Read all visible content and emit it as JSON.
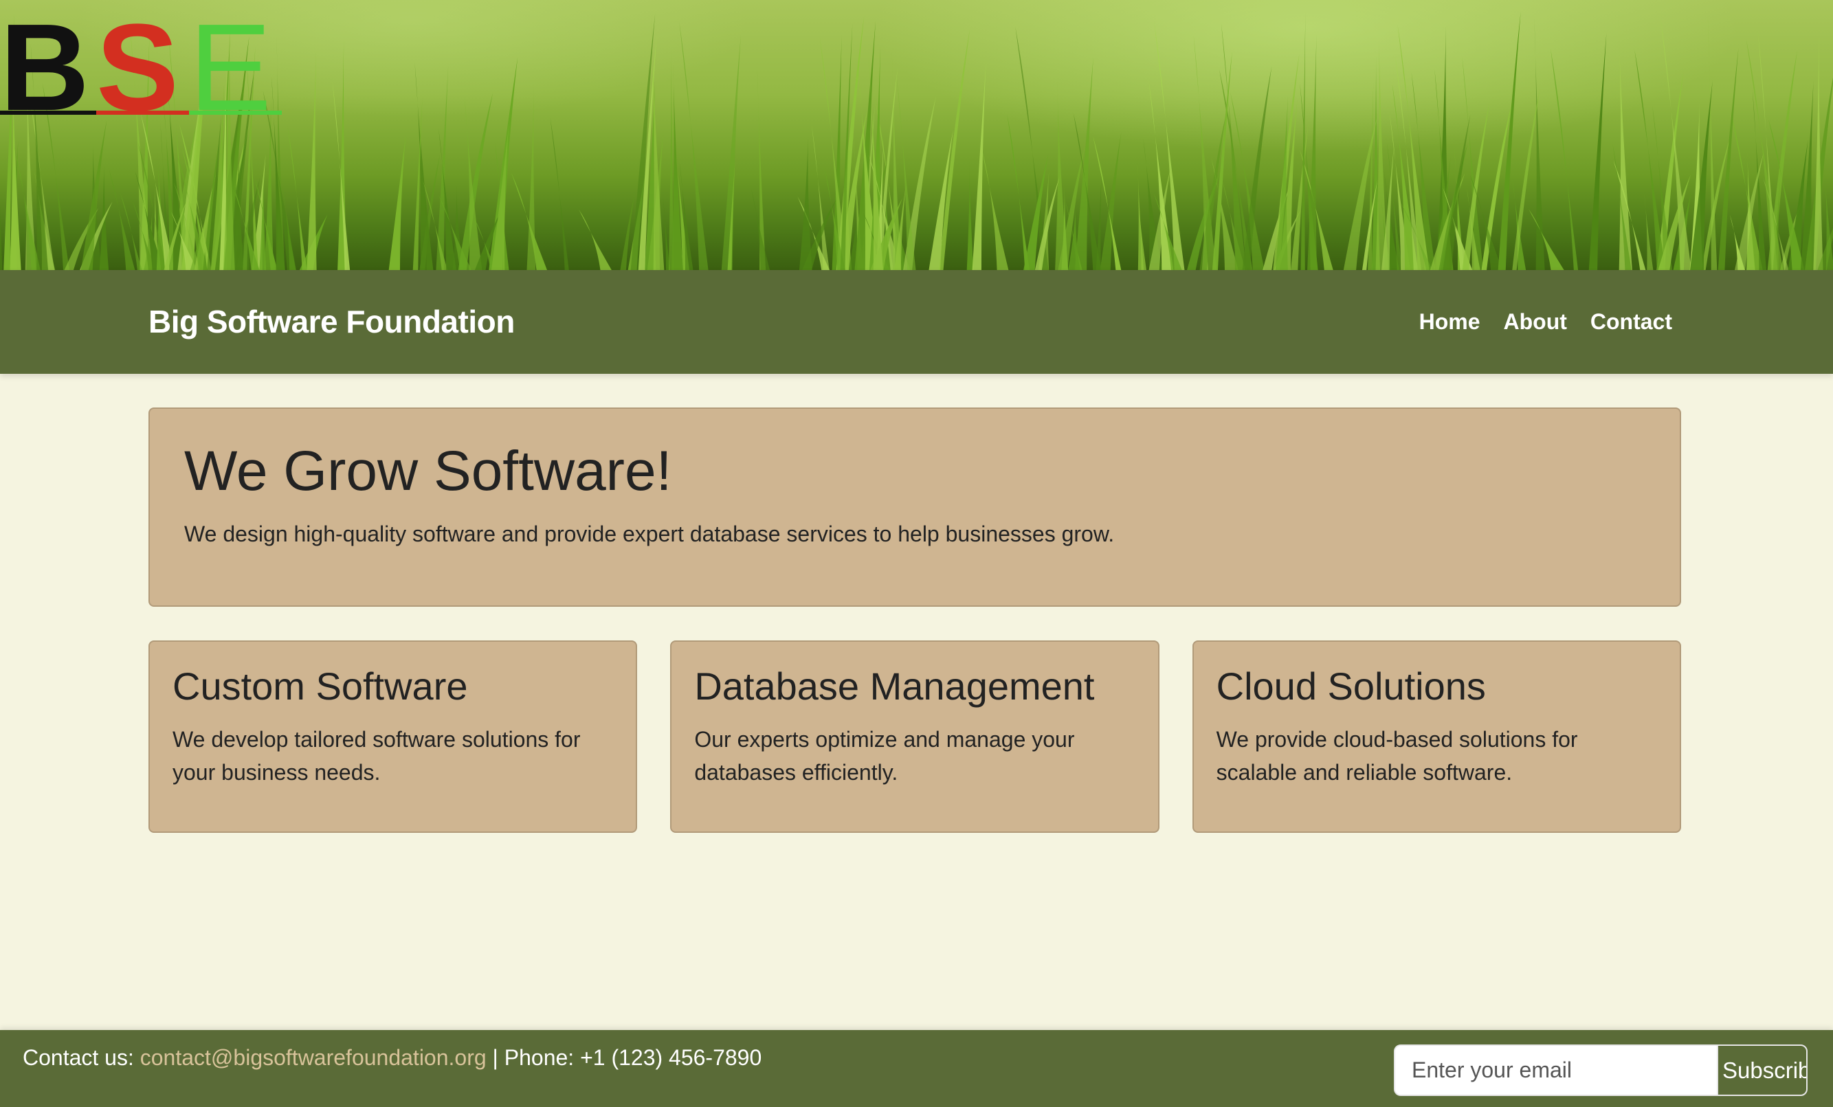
{
  "logo": {
    "letters": [
      "B",
      "S",
      "E"
    ],
    "colors": [
      "#111111",
      "#d32f20",
      "#4fcf3f"
    ]
  },
  "navbar": {
    "brand": "Big Software Foundation",
    "links": [
      {
        "label": "Home"
      },
      {
        "label": "About"
      },
      {
        "label": "Contact"
      }
    ]
  },
  "hero": {
    "title": "We Grow Software!",
    "subtitle": "We design high-quality software and provide expert database services to help businesses grow."
  },
  "cards": [
    {
      "title": "Custom Software",
      "text": "We develop tailored software solutions for your business needs."
    },
    {
      "title": "Database Management",
      "text": "Our experts optimize and manage your databases efficiently."
    },
    {
      "title": "Cloud Solutions",
      "text": "We provide cloud-based solutions for scalable and reliable software."
    }
  ],
  "footer": {
    "contact_prefix": "Contact us:",
    "email": "contact@bigsoftwarefoundation.org",
    "phone": " | Phone: +1 (123) 456-7890",
    "email_placeholder": "Enter your email",
    "subscribe_label": "Subscribe"
  },
  "colors": {
    "page_bg": "#f5f4e0",
    "nav_bg": "#5a6b37",
    "card_bg": "#cfb591",
    "link": "#d8c39a"
  }
}
